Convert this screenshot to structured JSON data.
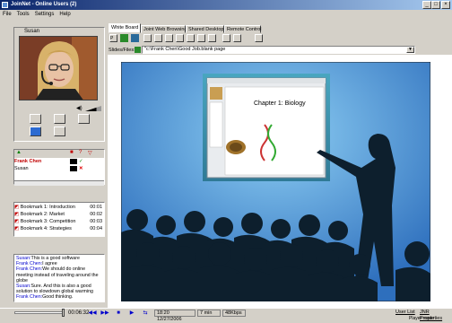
{
  "window": {
    "title": "JoinNet - Online Users (2)",
    "min": "_",
    "max": "□",
    "close": "×"
  },
  "menu": [
    "File",
    "Tools",
    "Settings",
    "Help"
  ],
  "video": {
    "name": "Susan"
  },
  "tabs": [
    "White Board",
    "Joint Web Browsing",
    "Shared Desktop",
    "Remote Control"
  ],
  "slides": {
    "label": "Slides/Files:",
    "value": "\"c:\\Frank Chen\\Good Job.blank page"
  },
  "slide": {
    "title": "Chapter 1: Biology"
  },
  "users": {
    "header_icons": [
      "▲",
      "■",
      "?"
    ],
    "list": [
      {
        "name": "Frank Chen",
        "status": "✓",
        "highlight": true
      },
      {
        "name": "Susan",
        "status": "✕",
        "highlight": false
      }
    ]
  },
  "bookmarks": [
    {
      "label": "Bookmark 1: Introduction",
      "time": "00:01"
    },
    {
      "label": "Bookmark 2: Market",
      "time": "00:02"
    },
    {
      "label": "Bookmark 3: Competition",
      "time": "00:03"
    },
    {
      "label": "Bookmark 4: Strategies",
      "time": "00:04"
    }
  ],
  "chat": [
    {
      "user": "Susan:",
      "text": "This is a good software"
    },
    {
      "user": "Frank Chen:",
      "text": "I agree"
    },
    {
      "user": "Frank Chen:",
      "text": "We should do online meeting instead of traveling around the globe"
    },
    {
      "user": "Susan:",
      "text": "Sure. And this is also a good solution to slowdown global warming"
    },
    {
      "user": "Frank Chen:",
      "text": "Good thinking."
    }
  ],
  "status": {
    "elapsed": "00:06:32",
    "datetime": "18:20 12/27/2006",
    "duration": "7 min",
    "bitrate": "48Kbps",
    "user_list": "User List",
    "jnr_properties": "JNR Properties",
    "player_mode": "Player mode",
    "buttons": [
      "◀◀",
      "▶▶",
      "■",
      "▶",
      "⇆"
    ]
  }
}
